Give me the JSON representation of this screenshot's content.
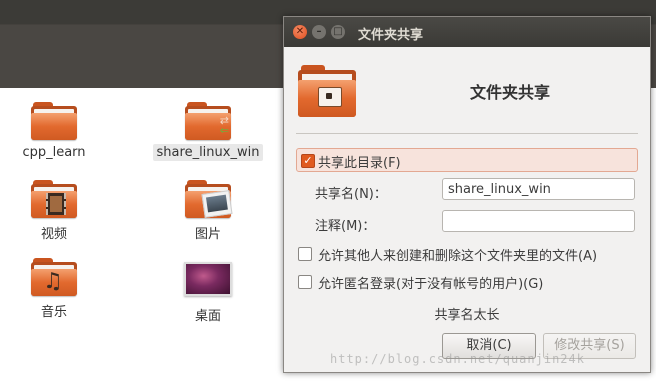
{
  "file_manager": {
    "items": [
      {
        "label": "cpp_learn",
        "icon": "folder-icon"
      },
      {
        "label": "share_linux_win",
        "icon": "shared-folder-icon",
        "selected": true
      },
      {
        "label": "视频",
        "icon": "videos-folder-icon"
      },
      {
        "label": "图片",
        "icon": "pictures-folder-icon"
      },
      {
        "label": "音乐",
        "icon": "music-folder-icon"
      },
      {
        "label": "桌面",
        "icon": "desktop-icon"
      }
    ]
  },
  "dialog": {
    "window_title": "文件夹共享",
    "window_buttons": {
      "close": "✕",
      "minimize": "–",
      "maximize": "□"
    },
    "heading": "文件夹共享",
    "share_checkbox": {
      "label": "共享此目录(F)",
      "checked": true
    },
    "share_name": {
      "label": "共享名(N)：",
      "value": "share_linux_win"
    },
    "comment": {
      "label": "注释(M)：",
      "value": ""
    },
    "allow_others": {
      "label": "允许其他人来创建和删除这个文件夹里的文件(A)",
      "checked": false
    },
    "guest_access": {
      "label": "允许匿名登录(对于没有帐号的用户)(G)",
      "checked": false
    },
    "status": "共享名太长",
    "buttons": {
      "cancel": "取消(C)",
      "modify": "修改共享(S)"
    }
  },
  "watermark": "http://blog.csdn.net/quanjin24k",
  "colors": {
    "accent": "#e05a1f",
    "folder": "#e2692e",
    "titlebar": "#3c3b37"
  }
}
